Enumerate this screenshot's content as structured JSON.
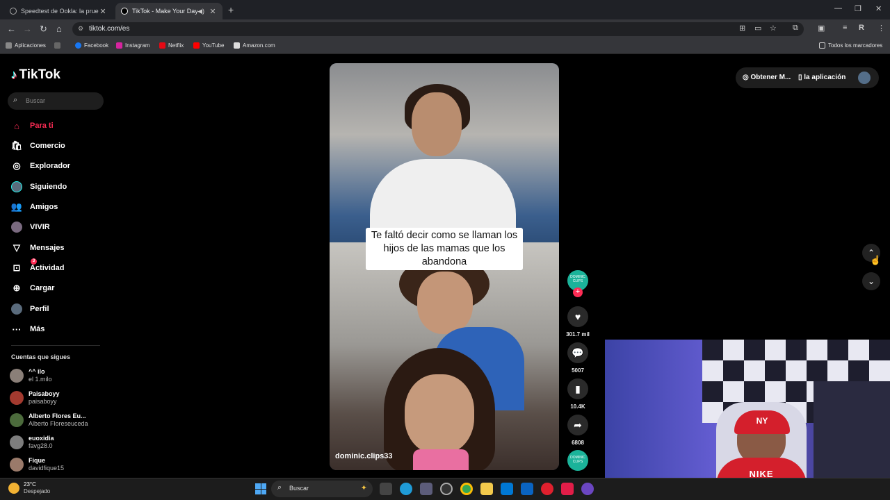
{
  "browser": {
    "tabs": [
      {
        "title": "Speedtest de Ookla: la prueba"
      },
      {
        "title": "TikTok - Make Your Day"
      }
    ],
    "url": "tiktok.com/es",
    "bookmarks": [
      "Aplicaciones",
      "Facebook",
      "Instagram",
      "Netflix",
      "YouTube",
      "Amazon.com"
    ],
    "all_bookmarks": "Todos los marcadores"
  },
  "tiktok": {
    "logo": "TikTok",
    "search_placeholder": "Buscar",
    "menu": [
      {
        "label": "Para ti",
        "icon": "home-icon"
      },
      {
        "label": "Comercio",
        "icon": "shop-icon"
      },
      {
        "label": "Explorador",
        "icon": "compass-icon"
      },
      {
        "label": "Siguiendo",
        "icon": "avatar-icon"
      },
      {
        "label": "Amigos",
        "icon": "friends-icon"
      },
      {
        "label": "VIVIR",
        "icon": "live-icon"
      },
      {
        "label": "Mensajes",
        "icon": "send-icon"
      },
      {
        "label": "Actividad",
        "icon": "inbox-icon",
        "badge": "3"
      },
      {
        "label": "Cargar",
        "icon": "plus-icon"
      },
      {
        "label": "Perfil",
        "icon": "profile-icon"
      },
      {
        "label": "Más",
        "icon": "more-icon"
      }
    ],
    "following_title": "Cuentas que sigues",
    "following": [
      {
        "name": "^^ ilo",
        "handle": "el 1.milo"
      },
      {
        "name": "Paisaboyy",
        "handle": "paisaboyy"
      },
      {
        "name": "Alberto Flores Eu...",
        "handle": "Alberto Floreseuceda"
      },
      {
        "name": "euoxidia",
        "handle": "favg28.0"
      },
      {
        "name": "Fique",
        "handle": "davidfique15"
      }
    ],
    "topright": {
      "get_coins": "Obtener M...",
      "app": "la aplicación"
    },
    "video": {
      "caption": "Te faltó decir como se llaman los hijos de las mamas que los abandona",
      "handle": "dominic.clips33",
      "avatar_text": "DOMINIC CLIPS",
      "likes": "301.7 mil",
      "comments": "5007",
      "saves": "10.4K",
      "shares": "6808"
    },
    "webcam_cap_text": "NY",
    "webcam_shirt_text": "NIKE"
  },
  "taskbar": {
    "temperature": "23°C",
    "condition": "Despejado",
    "search": "Buscar"
  },
  "colors": {
    "accent": "#fe2c55",
    "cyan": "#25f4ee"
  }
}
